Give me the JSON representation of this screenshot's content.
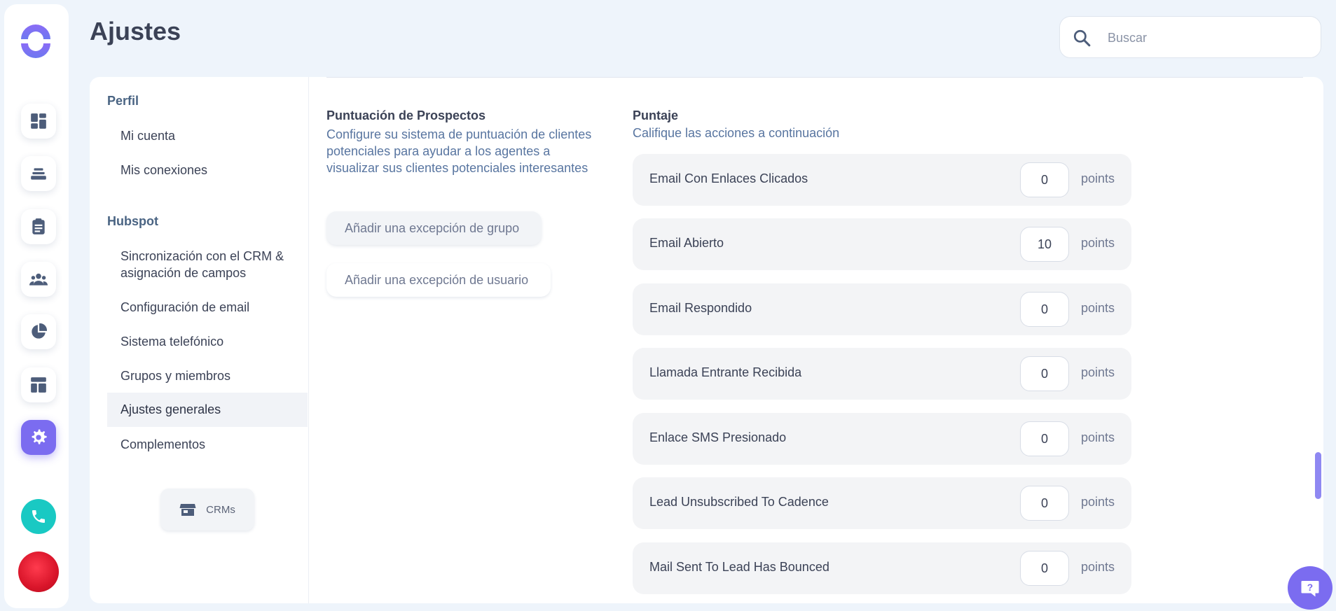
{
  "header": {
    "title": "Ajustes",
    "search_placeholder": "Buscar"
  },
  "rail": {
    "items": [
      "dashboard-icon",
      "stack-icon",
      "clipboard-icon",
      "team-icon",
      "pie-chart-icon",
      "layout-icon",
      "gear-icon"
    ],
    "active": "gear-icon"
  },
  "settings_nav": {
    "perfil": {
      "label": "Perfil",
      "items": [
        "Mi cuenta",
        "Mis conexiones"
      ]
    },
    "hubspot": {
      "label": "Hubspot",
      "items": [
        "Sincronización con el CRM & asignación de campos",
        "Configuración de email",
        "Sistema telefónico",
        "Grupos y miembros",
        "Ajustes generales",
        "Complementos"
      ],
      "active": "Ajustes generales"
    },
    "crms_button": "CRMs"
  },
  "lead_scoring": {
    "title": "Puntuación de Prospectos",
    "description": "Configure su sistema de puntuación de clientes potenciales para ayudar a los agentes a visualizar sus clientes potenciales interesantes",
    "group_exception_button": "Añadir una excepción de grupo",
    "user_exception_button": "Añadir una excepción de usuario"
  },
  "score": {
    "title": "Puntaje",
    "subtitle": "Califique las acciones a continuación",
    "unit": "points",
    "rows": [
      {
        "label": "Email Con Enlaces Clicados",
        "value": "0"
      },
      {
        "label": "Email Abierto",
        "value": "10"
      },
      {
        "label": "Email Respondido",
        "value": "0"
      },
      {
        "label": "Llamada Entrante Recibida",
        "value": "0"
      },
      {
        "label": "Enlace SMS Presionado",
        "value": "0"
      },
      {
        "label": "Lead Unsubscribed To Cadence",
        "value": "0"
      },
      {
        "label": "Mail Sent To Lead Has Bounced",
        "value": "0"
      }
    ]
  },
  "colors": {
    "accent": "#7b6cf0",
    "phone": "#19c9c3",
    "background": "#eef4fb"
  }
}
